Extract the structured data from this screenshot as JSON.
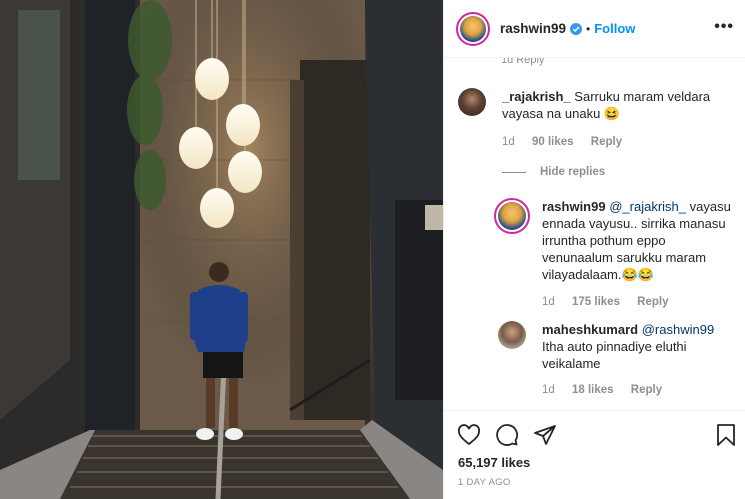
{
  "header": {
    "username": "rashwin99",
    "follow_label": "Follow",
    "separator": "•",
    "more_label": "•••"
  },
  "partial_row": {
    "text": "1d  Reply"
  },
  "comments": [
    {
      "username": "_rajakrish_",
      "text": "Sarruku maram veldara vayasa na unaku 😆",
      "time": "1d",
      "likes": "90 likes",
      "reply_label": "Reply"
    }
  ],
  "hide_replies_label": "Hide replies",
  "replies": [
    {
      "username": "rashwin99",
      "mention": "@_rajakrish_",
      "text": "vayasu ennada vayusu.. sirrika manasu irruntha pothum eppo venunaalum sarukku maram vilayadalaam.😂😂",
      "time": "1d",
      "likes": "175 likes",
      "reply_label": "Reply"
    },
    {
      "username": "maheshkumard",
      "mention": "@rashwin99",
      "text": "Itha auto pinnadiye eluthi veikalame",
      "time": "1d",
      "likes": "18 likes",
      "reply_label": "Reply"
    }
  ],
  "post": {
    "likes": "65,197 likes",
    "time": "1 DAY AGO"
  },
  "icons": [
    "heart-icon",
    "comment-icon",
    "share-icon",
    "bookmark-icon",
    "verified-icon",
    "more-icon"
  ],
  "colors": {
    "link": "#0095f6",
    "mention": "#00376b",
    "muted": "#8e8e8e",
    "text": "#262626",
    "story_ring": "#d6249f"
  }
}
